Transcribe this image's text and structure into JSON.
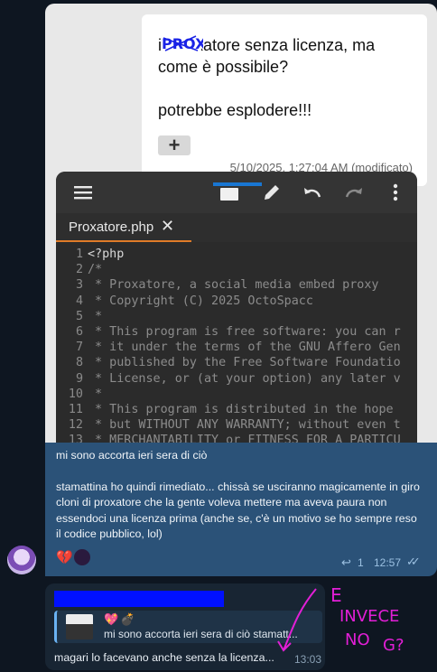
{
  "photo_note": {
    "line1": "il Proxatore senza licenza, ma",
    "line2": "come è possibile?",
    "line3": "potrebbe esplodere!!!",
    "scribble_word": "PROX",
    "plus_label": "+",
    "date": "5/10/2025, 1:27:04 AM (modificato)"
  },
  "editor": {
    "tab_name": "Proxatore.php",
    "tab_close": "✕",
    "lines": [
      {
        "n": "1",
        "t": "<?php"
      },
      {
        "n": "2",
        "t": "/*"
      },
      {
        "n": "3",
        "t": " * Proxatore, a social media embed proxy"
      },
      {
        "n": "4",
        "t": " * Copyright (C) 2025 OctoSpacc"
      },
      {
        "n": "5",
        "t": " *"
      },
      {
        "n": "6",
        "t": " * This program is free software: you can r"
      },
      {
        "n": "7",
        "t": " * it under the terms of the GNU Affero Gen"
      },
      {
        "n": "8",
        "t": " * published by the Free Software Foundatio"
      },
      {
        "n": "9",
        "t": " * License, or (at your option) any later v"
      },
      {
        "n": "10",
        "t": " *"
      },
      {
        "n": "11",
        "t": " * This program is distributed in the hope "
      },
      {
        "n": "12",
        "t": " * but WITHOUT ANY WARRANTY; without even t"
      },
      {
        "n": "13",
        "t": " * MERCHANTABILITY or FITNESS FOR A PARTICU"
      }
    ]
  },
  "message": {
    "line1": "mi sono accorta ieri sera di ciò",
    "body": "stamattina ho quindi rimediato... chissà se usciranno magicamente in giro cloni di proxatore che la gente voleva mettere ma aveva paura non essendoci una licenza prima (anche se, c'è un motivo se ho sempre reso il codice pubblico, lol)",
    "reactions": [
      "💔",
      "⚫"
    ],
    "reply_count": "1",
    "time": "12:57"
  },
  "reply": {
    "quote_text": "mi sono accorta ieri sera di ciò  stamatt...",
    "text": "magari lo facevano anche senza la licenza...",
    "time": "13:03"
  },
  "handwriting": {
    "line1": "E",
    "line2": "INVECE",
    "line3": "NO",
    "line4": "G?"
  },
  "colors": {
    "background": "#0e1621",
    "outgoing_bubble": "#2b5278",
    "incoming_bubble": "#182533",
    "annotation_magenta": "#e21fd6",
    "redaction_blue": "#0010ff",
    "tab_accent": "#e07b28"
  },
  "icons": {
    "editor_toolbar": [
      "menu-icon",
      "pen-icon",
      "undo-icon",
      "redo-icon",
      "more-vertical-icon"
    ],
    "meta": [
      "reply-icon",
      "double-check-icon"
    ]
  }
}
